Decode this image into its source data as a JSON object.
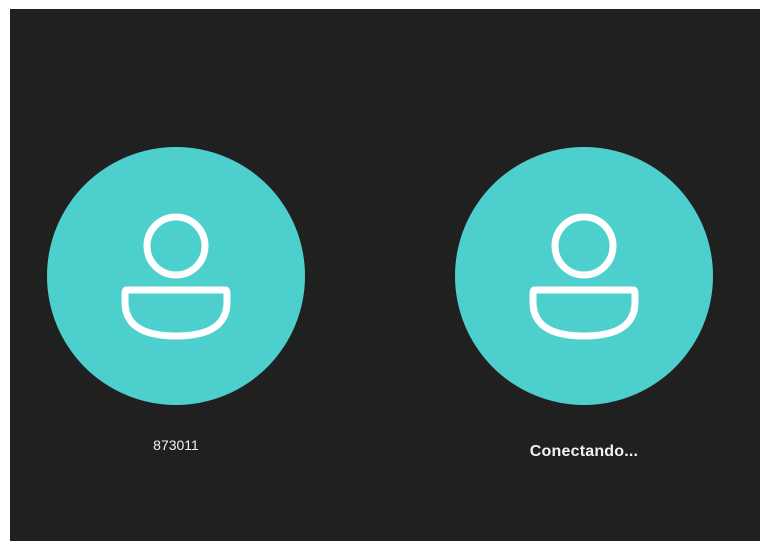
{
  "call": {
    "participants": [
      {
        "name": "873011",
        "avatar_icon": "person-icon"
      },
      {
        "name": "Conectando...",
        "avatar_icon": "person-icon"
      }
    ],
    "colors": {
      "background": "#202020",
      "avatar": "#4dd0cd",
      "text": "#f2f2f2"
    }
  }
}
